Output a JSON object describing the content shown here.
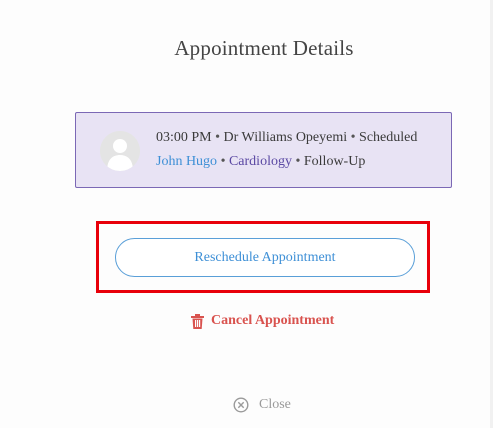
{
  "modal": {
    "title": "Appointment Details"
  },
  "appointment": {
    "time": "03:00 PM",
    "doctor": "Dr Williams Opeyemi",
    "status": "Scheduled",
    "patient": "John Hugo",
    "department": "Cardiology",
    "type": "Follow-Up",
    "separator": "•",
    "avatar_icon": "user-avatar-icon"
  },
  "actions": {
    "reschedule_label": "Reschedule Appointment",
    "cancel_label": "Cancel Appointment",
    "cancel_icon": "trash-icon",
    "close_label": "Close",
    "close_icon": "close-circle-icon"
  },
  "colors": {
    "card_bg": "#e8e3f4",
    "card_border": "#7b68b5",
    "link_blue": "#3d8fd6",
    "department_purple": "#5a48a3",
    "cancel_red": "#d9534f",
    "highlight_red": "#e8000a"
  }
}
